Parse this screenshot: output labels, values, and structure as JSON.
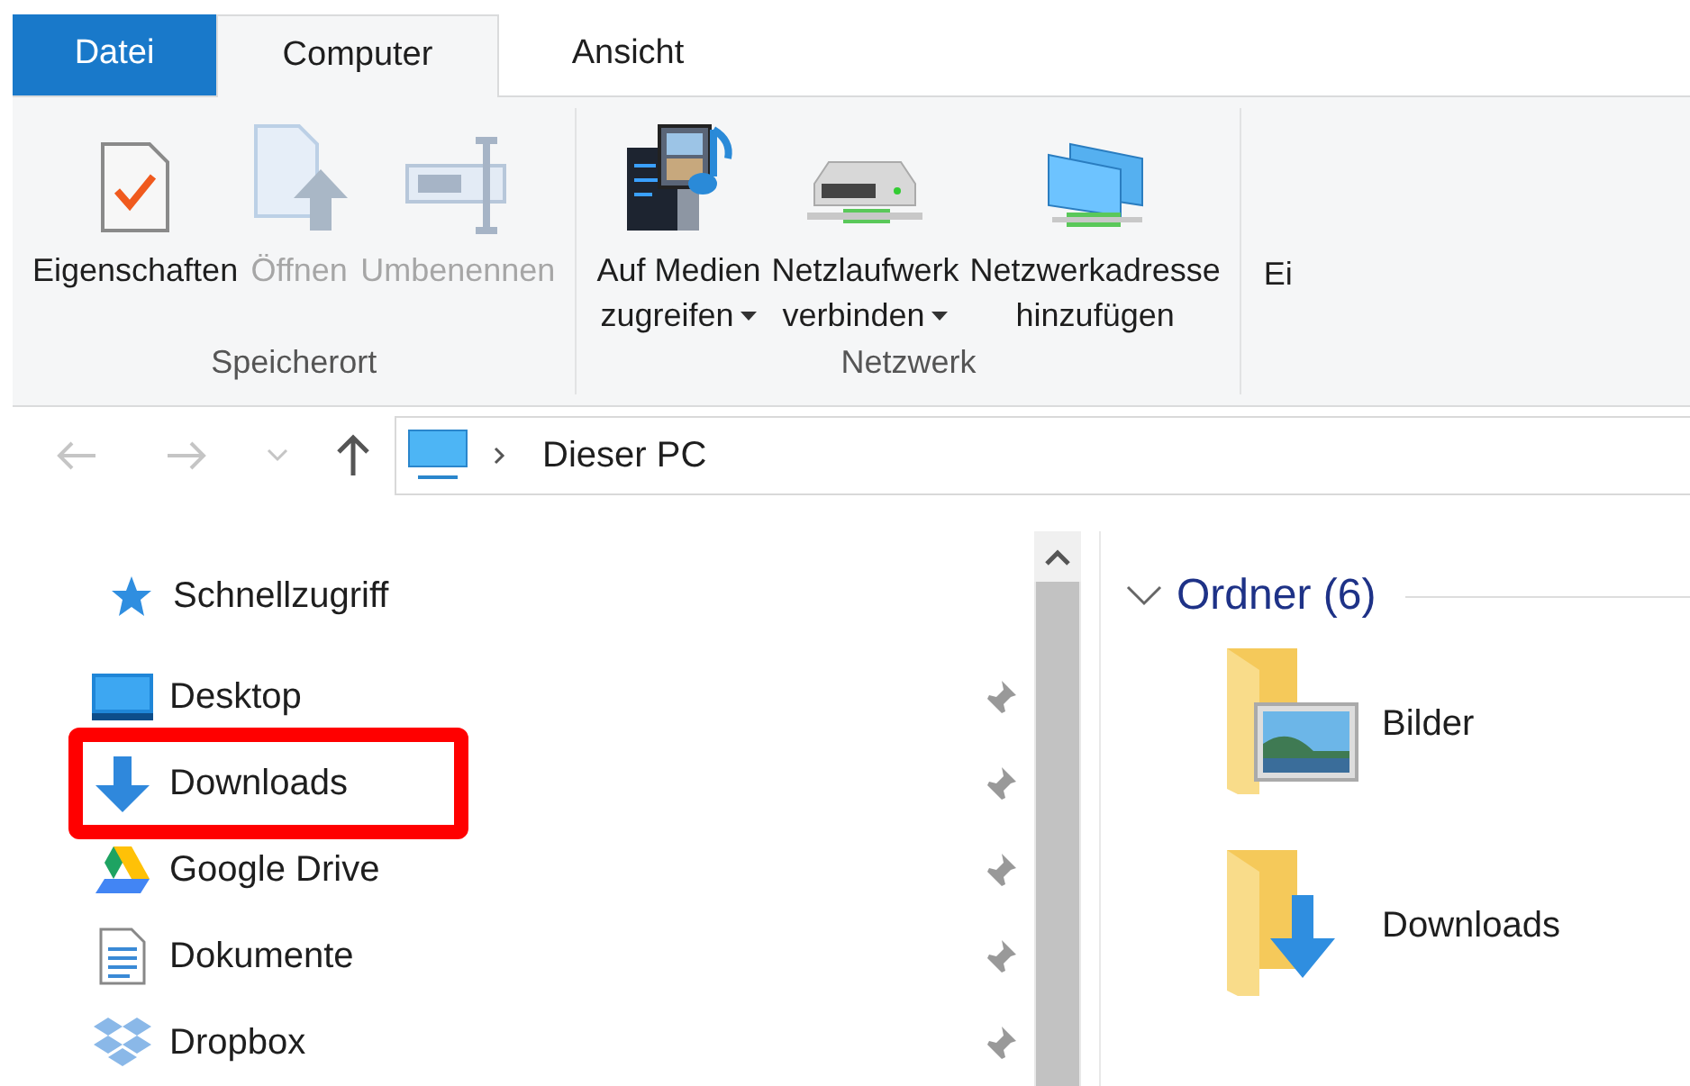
{
  "tabs": [
    {
      "label": "Datei",
      "kind": "file"
    },
    {
      "label": "Computer",
      "selected": true,
      "kind": "tab"
    },
    {
      "label": "Ansicht",
      "selected": false,
      "kind": "tab"
    }
  ],
  "ribbon": {
    "groups": [
      {
        "label": "Speicherort",
        "buttons": [
          {
            "kind": "properties",
            "lines": [
              "Eigenschaften"
            ],
            "disabled": false,
            "dropdown": false
          },
          {
            "kind": "open",
            "lines": [
              "Öffnen"
            ],
            "disabled": true,
            "dropdown": false
          },
          {
            "kind": "rename",
            "lines": [
              "Umbenennen"
            ],
            "disabled": true,
            "dropdown": false
          }
        ]
      },
      {
        "label": "Netzwerk",
        "buttons": [
          {
            "kind": "media",
            "lines": [
              "Auf Medien",
              "zugreifen"
            ],
            "disabled": false,
            "dropdown": true
          },
          {
            "kind": "drive",
            "lines": [
              "Netzlaufwerk",
              "verbinden"
            ],
            "disabled": false,
            "dropdown": true
          },
          {
            "kind": "address",
            "lines": [
              "Netzwerkadresse",
              "hinzufügen"
            ],
            "disabled": false,
            "dropdown": false
          }
        ]
      }
    ],
    "cut_label": "Ei"
  },
  "address_bar": {
    "path": "Dieser PC"
  },
  "navigation": {
    "header": "Schnellzugriff",
    "items": [
      {
        "label": "Desktop",
        "kind": "desktop",
        "highlighted": false
      },
      {
        "label": "Downloads",
        "kind": "downloads",
        "highlighted": true
      },
      {
        "label": "Google Drive",
        "kind": "drive",
        "highlighted": false
      },
      {
        "label": "Dokumente",
        "kind": "documents",
        "highlighted": false
      },
      {
        "label": "Dropbox",
        "kind": "dropbox",
        "highlighted": false
      }
    ]
  },
  "content": {
    "group_title": "Ordner (6)",
    "expanded": true,
    "folders": [
      {
        "label": "Bilder",
        "kind": "pictures"
      },
      {
        "label": "Downloads",
        "kind": "downloads"
      }
    ]
  }
}
